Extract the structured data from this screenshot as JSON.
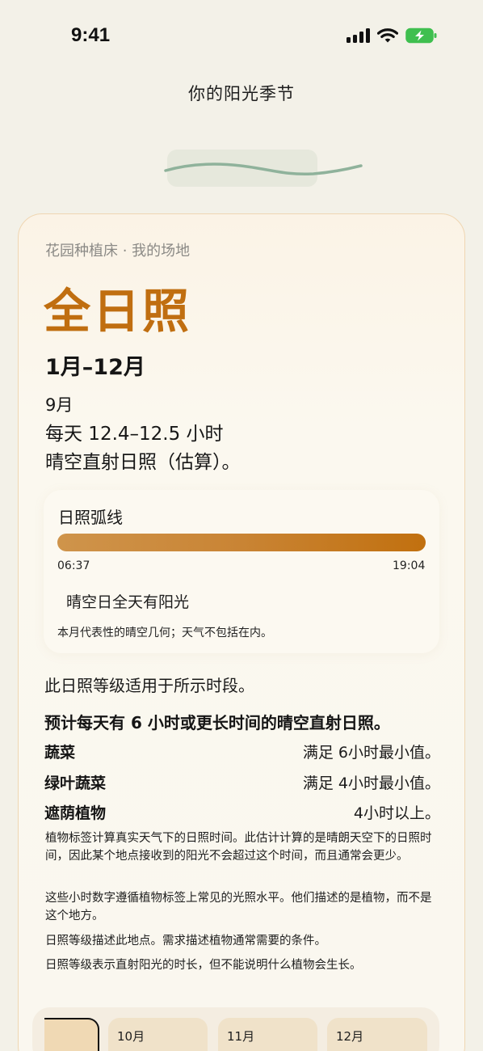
{
  "status_bar": {
    "time": "9:41"
  },
  "header": {
    "title": "你的阳光季节"
  },
  "card": {
    "site": "花园种植床 · 我的场地",
    "rating": "全日照",
    "range": "1月–12月",
    "month": "9月",
    "hours_line1": "每天 12.4–12.5 小时",
    "hours_line2": "晴空直射日照（估算）。"
  },
  "sun_arc": {
    "title": "日照弧线",
    "sunrise": "06:37",
    "sunset": "19:04",
    "clear_day": "晴空日全天有阳光",
    "note": "本月代表性的晴空几何；天气不包括在内。"
  },
  "requirements": {
    "applies": "此日照等级适用于所示时段。",
    "expect": "预计每天有 6 小时或更长时间的晴空直射日照。",
    "rows": [
      {
        "name": "蔬菜",
        "value": "满足 6小时最小值。"
      },
      {
        "name": "绿叶蔬菜",
        "value": "满足 4小时最小值。"
      },
      {
        "name": "遮荫植物",
        "value": "4小时以上。"
      }
    ]
  },
  "notes": [
    "植物标签计算真实天气下的日照时间。此估计计算的是晴朗天空下的日照时间，因此某个地点接收到的阳光不会超过这个时间，而且通常会更少。",
    "这些小时数字遵循植物标签上常见的光照水平。他们描述的是植物，而不是这个地方。",
    "日照等级描述此地点。需求描述植物通常需要的条件。",
    "日照等级表示直射阳光的时长，但不能说明什么植物会生长。"
  ],
  "month_tabs": [
    "",
    "10月",
    "11月",
    "12月"
  ],
  "colors": {
    "accent": "#c06e10",
    "background": "#f3f1e8",
    "handle": "#8fb29b"
  }
}
